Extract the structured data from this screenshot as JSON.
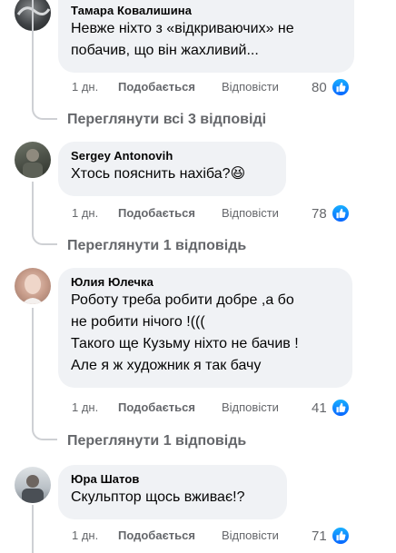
{
  "comments": [
    {
      "author": "Тамара Ковалишина",
      "text": "Невже ніхто з «відкриваючих» не\nпобачив, що він жахливий...",
      "time": "1 дн.",
      "like_label": "Подобається",
      "reply_label": "Відповісти",
      "reactions": "80",
      "view_replies": "Переглянути всі 3 відповіді"
    },
    {
      "author": "Sergey Antonovih",
      "text": "Хтось пояснить нахіба?😆",
      "time": "1 дн.",
      "like_label": "Подобається",
      "reply_label": "Відповісти",
      "reactions": "78",
      "view_replies": "Переглянути 1 відповідь"
    },
    {
      "author": "Юлия Юлечка",
      "text": "Роботу треба робити добре ,а бо\nне робити нічого !(((\nТакого ще Кузьму ніхто не бачив !\nАле я ж художник я так бачу",
      "time": "1 дн.",
      "like_label": "Подобається",
      "reply_label": "Відповісти",
      "reactions": "41",
      "view_replies": "Переглянути 1 відповідь"
    },
    {
      "author": "Юра Шатов",
      "text": "Скульптор щось вживає!?",
      "time": "1 дн.",
      "like_label": "Подобається",
      "reply_label": "Відповісти",
      "reactions": "71"
    }
  ],
  "colors": {
    "bubble": "#f0f2f5",
    "muted": "#65676b",
    "like_blue": "#0866ff",
    "connector": "#ced0d4"
  },
  "icons": {
    "reaction": "thumbs-up-icon"
  }
}
